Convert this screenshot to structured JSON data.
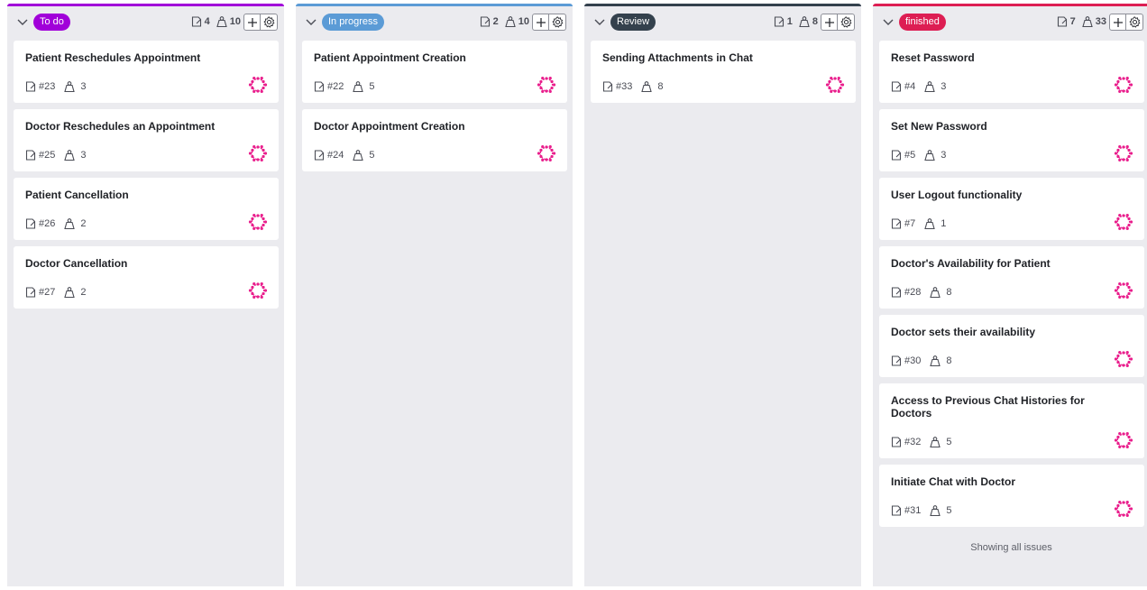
{
  "columns": [
    {
      "name": "To do",
      "badge_color": "#a100d9",
      "bar_color": "#a100d9",
      "issue_count": "4",
      "weight": "10",
      "cards": [
        {
          "title": "Patient Reschedules Appointment",
          "id": "#23",
          "weight": "3"
        },
        {
          "title": "Doctor Reschedules an Appointment",
          "id": "#25",
          "weight": "3"
        },
        {
          "title": "Patient Cancellation",
          "id": "#26",
          "weight": "2"
        },
        {
          "title": "Doctor Cancellation",
          "id": "#27",
          "weight": "2"
        }
      ]
    },
    {
      "name": "In progress",
      "badge_color": "#5b9bd6",
      "bar_color": "#5b9bd6",
      "issue_count": "2",
      "weight": "10",
      "cards": [
        {
          "title": "Patient Appointment Creation",
          "id": "#22",
          "weight": "5"
        },
        {
          "title": "Doctor Appointment Creation",
          "id": "#24",
          "weight": "5"
        }
      ]
    },
    {
      "name": "Review",
      "badge_color": "#34414d",
      "bar_color": "#34414d",
      "issue_count": "1",
      "weight": "8",
      "cards": [
        {
          "title": "Sending Attachments in Chat",
          "id": "#33",
          "weight": "8"
        }
      ]
    },
    {
      "name": "finished",
      "badge_color": "#dd1e53",
      "bar_color": "#dd1e53",
      "issue_count": "7",
      "weight": "33",
      "cards": [
        {
          "title": "Reset Password",
          "id": "#4",
          "weight": "3"
        },
        {
          "title": "Set New Password",
          "id": "#5",
          "weight": "3"
        },
        {
          "title": "User Logout functionality",
          "id": "#7",
          "weight": "1"
        },
        {
          "title": "Doctor's Availability for Patient",
          "id": "#28",
          "weight": "8"
        },
        {
          "title": "Doctor sets their availability",
          "id": "#30",
          "weight": "8"
        },
        {
          "title": "Access to Previous Chat Histories for Doctors",
          "id": "#32",
          "weight": "5"
        },
        {
          "title": "Initiate Chat with Doctor",
          "id": "#31",
          "weight": "5"
        }
      ],
      "footer": "Showing all issues"
    }
  ],
  "icons": {
    "collapse": "chevron-down-icon",
    "issues": "issues-icon",
    "weight": "weight-icon",
    "add": "plus-icon",
    "settings": "gear-icon",
    "avatar": "avatar-icon"
  },
  "avatar_color": "#e91e8c"
}
